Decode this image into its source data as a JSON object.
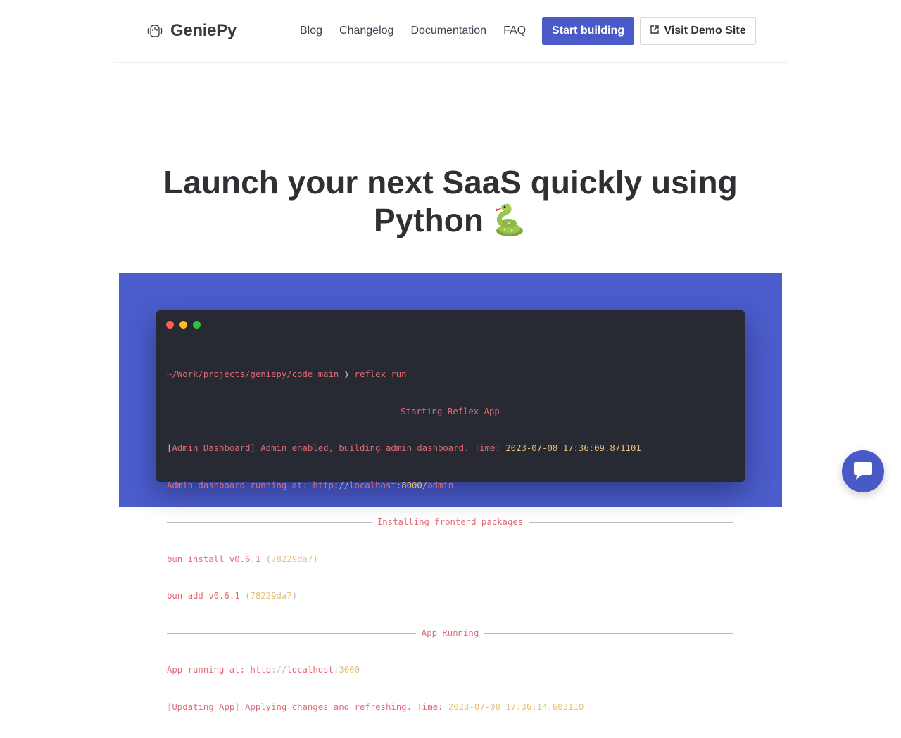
{
  "header": {
    "brand": "GeniePy",
    "nav": [
      "Blog",
      "Changelog",
      "Documentation",
      "FAQ"
    ],
    "primary_cta": "Start building",
    "secondary_cta": "Visit Demo Site"
  },
  "hero": {
    "title_line1": "Launch your next SaaS quickly using",
    "title_line2": "Python"
  },
  "terminal": {
    "prompt_path": "~/Work/projects/geniepy/code",
    "prompt_branch": "main",
    "prompt_symbol": "❯",
    "command": "reflex run",
    "section1": "Starting Reflex App",
    "admin_tag": "Admin Dashboard",
    "admin_msg": "Admin enabled, building admin dashboard.",
    "time_label": "Time:",
    "time1": "2023-07-08 17:36:09.871101",
    "admin_url_label": "Admin dashboard running at:",
    "admin_url_scheme": "http",
    "admin_url_host": "localhost",
    "admin_url_port": "8000",
    "admin_url_path": "admin",
    "section2": "Installing frontend packages",
    "bun_install": "bun install v0.6.1",
    "bun_add": "bun add v0.6.1",
    "bun_hash": "78229da7",
    "section3": "App Running",
    "app_url_label": "App running at:",
    "app_url_scheme": "http",
    "app_url_host": "localhost",
    "app_url_port": "3000",
    "update_tag": "Updating App",
    "update_msg": "Applying changes and refreshing.",
    "time2": "2023-07-08 17:36:14.603110"
  },
  "colors": {
    "accent": "#4a5bc9",
    "showcase_bg": "#4c5dcc",
    "terminal_bg": "#272a32",
    "dot_red": "#ff5f57",
    "dot_yellow": "#febc2e",
    "dot_green": "#28c840"
  },
  "icons": {
    "brand": "genie-lamp-icon",
    "external": "external-link-icon",
    "chat": "chat-bubble-icon",
    "emoji": "snake-emoji"
  }
}
